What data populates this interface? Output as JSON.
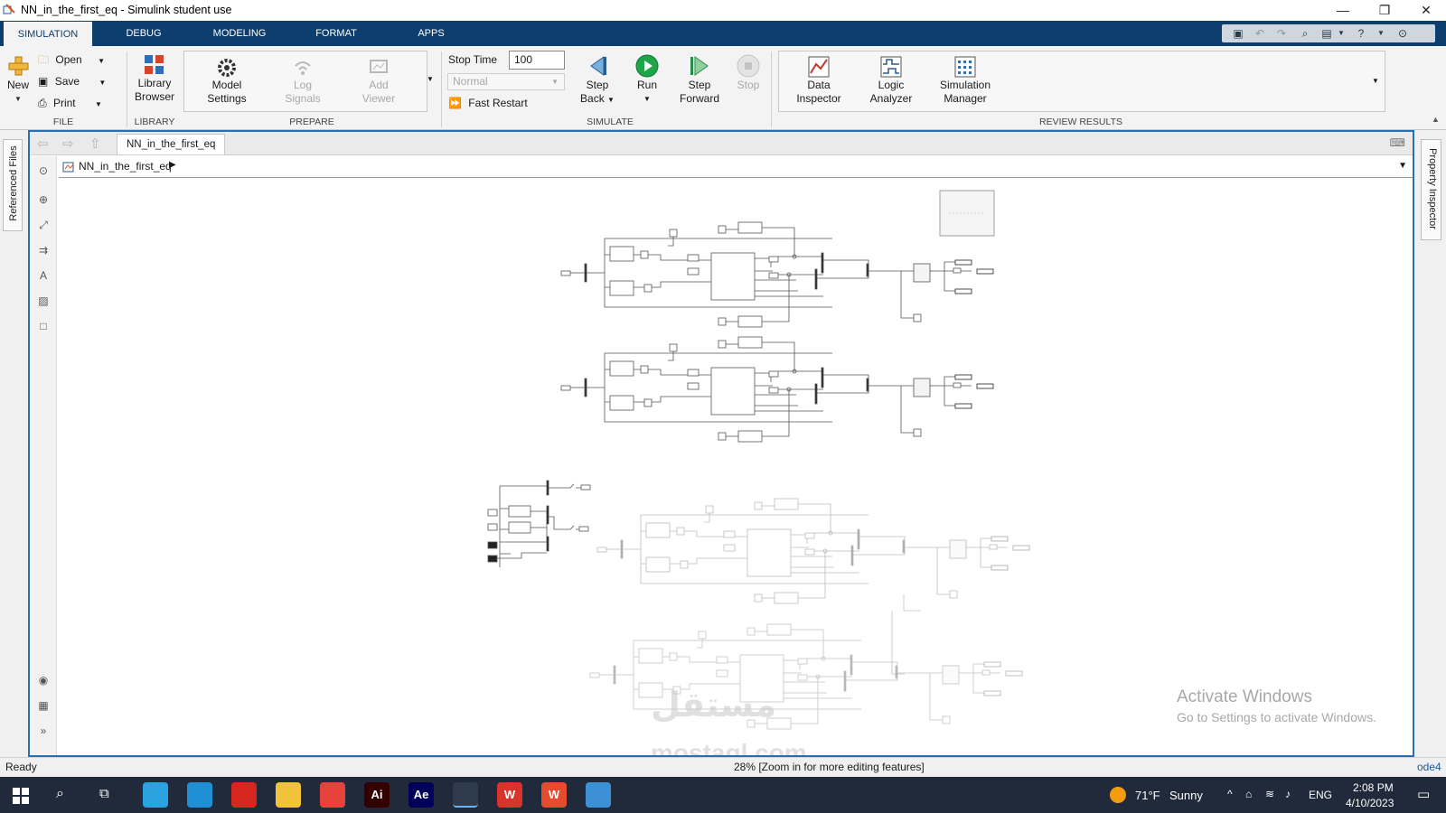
{
  "window": {
    "title": "NN_in_the_first_eq - Simulink student use"
  },
  "tabs": [
    "SIMULATION",
    "DEBUG",
    "MODELING",
    "FORMAT",
    "APPS"
  ],
  "ribbon": {
    "file": {
      "new_label": "New",
      "open_label": "Open",
      "save_label": "Save",
      "print_label": "Print",
      "group_label": "FILE"
    },
    "library": {
      "browser_label_1": "Library",
      "browser_label_2": "Browser",
      "group_label": "LIBRARY"
    },
    "prepare": {
      "model_settings_1": "Model",
      "model_settings_2": "Settings",
      "log_signals_1": "Log",
      "log_signals_2": "Signals",
      "add_viewer_1": "Add",
      "add_viewer_2": "Viewer",
      "group_label": "PREPARE"
    },
    "simulate": {
      "stop_time_label": "Stop Time",
      "stop_time_value": "100",
      "mode_value": "Normal",
      "fast_restart_label": "Fast Restart",
      "step_back_1": "Step",
      "step_back_2": "Back",
      "run_label": "Run",
      "step_forward_1": "Step",
      "step_forward_2": "Forward",
      "stop_label": "Stop",
      "group_label": "SIMULATE"
    },
    "review": {
      "data_inspector_1": "Data",
      "data_inspector_2": "Inspector",
      "logic_analyzer_1": "Logic",
      "logic_analyzer_2": "Analyzer",
      "sim_manager_1": "Simulation",
      "sim_manager_2": "Manager",
      "group_label": "REVIEW RESULTS"
    }
  },
  "side_panels": {
    "left_tab": "Referenced Files",
    "right_tab": "Property Inspector"
  },
  "editor": {
    "doc_tab": "NN_in_the_first_eq",
    "breadcrumb": "NN_in_the_first_eq"
  },
  "canvas": {
    "watermark_line1": "Activate Windows",
    "watermark_line2": "Go to Settings to activate Windows.",
    "logo_text": "mostaql.com",
    "logo_arabic": "مستقل"
  },
  "status": {
    "left": "Ready",
    "center": "28% [Zoom in for more editing features]",
    "right": "ode4"
  },
  "taskbar": {
    "apps": [
      {
        "name": "telegram",
        "label": "",
        "color": "#2aa3e0"
      },
      {
        "name": "edge",
        "label": "",
        "color": "#1f8fd6"
      },
      {
        "name": "acrobat",
        "label": "",
        "color": "#d7261e"
      },
      {
        "name": "file-explorer",
        "label": "",
        "color": "#f2c23a"
      },
      {
        "name": "chrome",
        "label": "",
        "color": "#e6423a"
      },
      {
        "name": "illustrator",
        "label": "Ai",
        "color": "#330000"
      },
      {
        "name": "after-effects",
        "label": "Ae",
        "color": "#00005b"
      },
      {
        "name": "matlab",
        "label": "",
        "color": "#2e3a4e"
      },
      {
        "name": "wps-writer",
        "label": "W",
        "color": "#d9342b"
      },
      {
        "name": "wps-office",
        "label": "W",
        "color": "#e44b2f"
      },
      {
        "name": "paint",
        "label": "",
        "color": "#3d8fd6"
      }
    ],
    "weather_temp": "71°F",
    "weather_text": "Sunny",
    "lang": "ENG",
    "time": "2:08 PM",
    "date": "4/10/2023"
  },
  "colors": {
    "tab_bar": "#0d3e6e",
    "editor_border": "#2b6fb3",
    "run_green": "#1ea548",
    "taskbar": "#202a3a"
  }
}
